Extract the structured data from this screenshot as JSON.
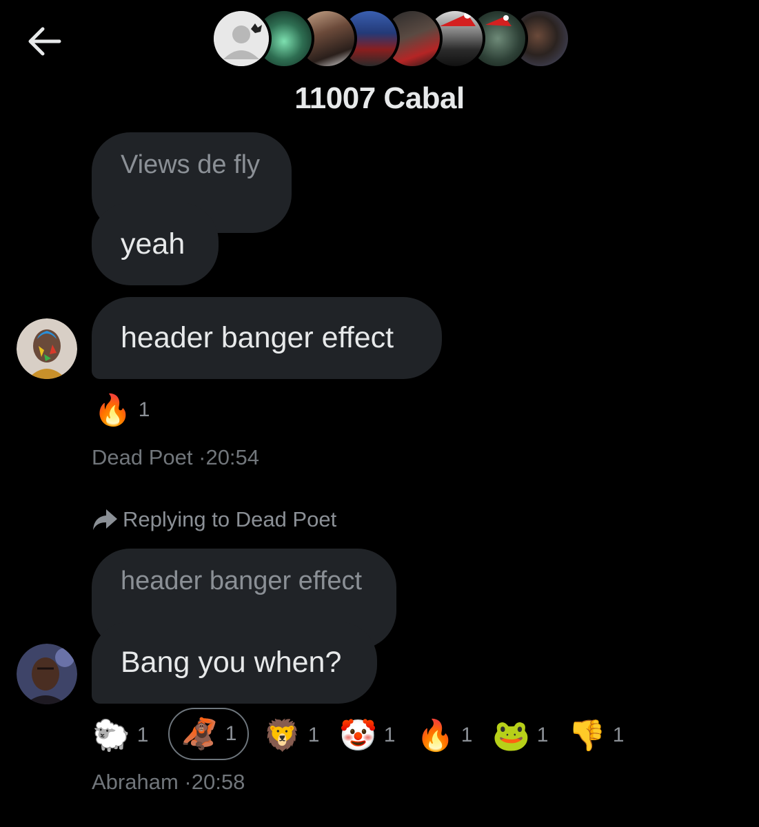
{
  "header": {
    "title": "11007 Cabal",
    "back_icon": "arrow-left-icon",
    "avatar_count": 8
  },
  "messages": [
    {
      "quoted_text": "Views de fly",
      "text": "yeah"
    },
    {
      "text": "header banger effect",
      "reactions": [
        {
          "emoji": "🔥",
          "count": "1"
        }
      ],
      "sender": "Dead Poet",
      "time": "·20:54"
    },
    {
      "reply_context": "Replying to Dead Poet",
      "quoted_text": "header banger effect",
      "text": "Bang you when?",
      "reactions": [
        {
          "emoji": "🐑",
          "count": "1"
        },
        {
          "emoji": "🦧",
          "count": "1",
          "selected": true
        },
        {
          "emoji": "🦁",
          "count": "1"
        },
        {
          "emoji": "🤡",
          "count": "1"
        },
        {
          "emoji": "🔥",
          "count": "1"
        },
        {
          "emoji": "🐸",
          "count": "1"
        },
        {
          "emoji": "👎",
          "count": "1"
        }
      ],
      "sender": "Abraham",
      "time": "·20:58"
    }
  ],
  "colors": {
    "background": "#000000",
    "bubble": "#202327",
    "text": "#e7e9ea",
    "muted": "#71767b"
  }
}
